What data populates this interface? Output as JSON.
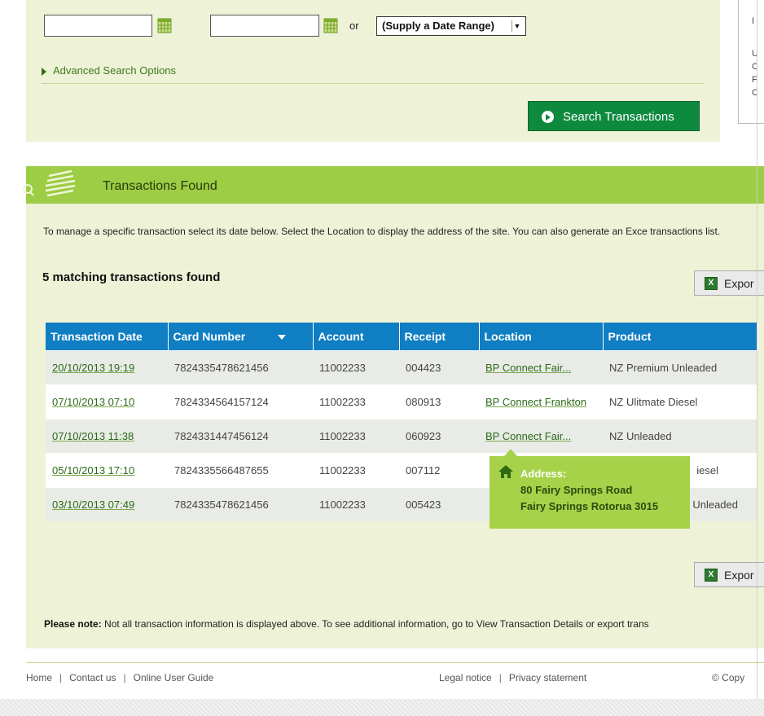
{
  "search": {
    "or_label": "or",
    "range_select": "(Supply a Date Range)",
    "advanced_label": "Advanced Search Options",
    "search_button": "Search Transactions"
  },
  "results": {
    "title": "Transactions Found",
    "intro": "To manage a specific transaction select its date below. Select the Location to display the address of the site. You can also generate an Exce transactions list.",
    "count": "5 matching transactions found",
    "export_label": "Expor",
    "columns": [
      "Transaction Date",
      "Card Number",
      "Account",
      "Receipt",
      "Location",
      "Product"
    ],
    "rows": [
      {
        "date": "20/10/2013 19:19",
        "card": "7824335478621456",
        "account": "11002233",
        "receipt": "004423",
        "location": "BP Connect Fair...",
        "product": "NZ Premium Unleaded"
      },
      {
        "date": "07/10/2013 07:10",
        "card": "7824334564157124",
        "account": "11002233",
        "receipt": "080913",
        "location": "BP Connect Frankton",
        "product": "NZ Ulitmate Diesel"
      },
      {
        "date": "07/10/2013 11:38",
        "card": "7824331447456124",
        "account": "11002233",
        "receipt": "060923",
        "location": "BP Connect Fair...",
        "product": "NZ Unleaded"
      },
      {
        "date": "05/10/2013 17:10",
        "card": "7824335566487655",
        "account": "11002233",
        "receipt": "007112",
        "location": "",
        "product": "iesel"
      },
      {
        "date": "03/10/2013 07:49",
        "card": "7824335478621456",
        "account": "11002233",
        "receipt": "005423",
        "location": "",
        "product": "Unleaded"
      }
    ],
    "tooltip": {
      "heading": "Address:",
      "line1": "80 Fairy Springs Road",
      "line2": "Fairy Springs Rotorua 3015"
    },
    "note_bold": "Please note:",
    "note_text": " Not all transaction information is displayed above. To see additional information, go to View Transaction Details or export trans"
  },
  "footer": {
    "home": "Home",
    "contact": "Contact us",
    "guide": "Online User Guide",
    "legal": "Legal notice",
    "privacy": "Privacy statement",
    "copyright": "© Copy"
  },
  "colors": {
    "panel_bg": "#eef2d7",
    "header_green": "#9dcc45",
    "button_green": "#0e8a3f",
    "table_header_blue": "#0f7ec2",
    "tooltip_green": "#a6d24a"
  }
}
